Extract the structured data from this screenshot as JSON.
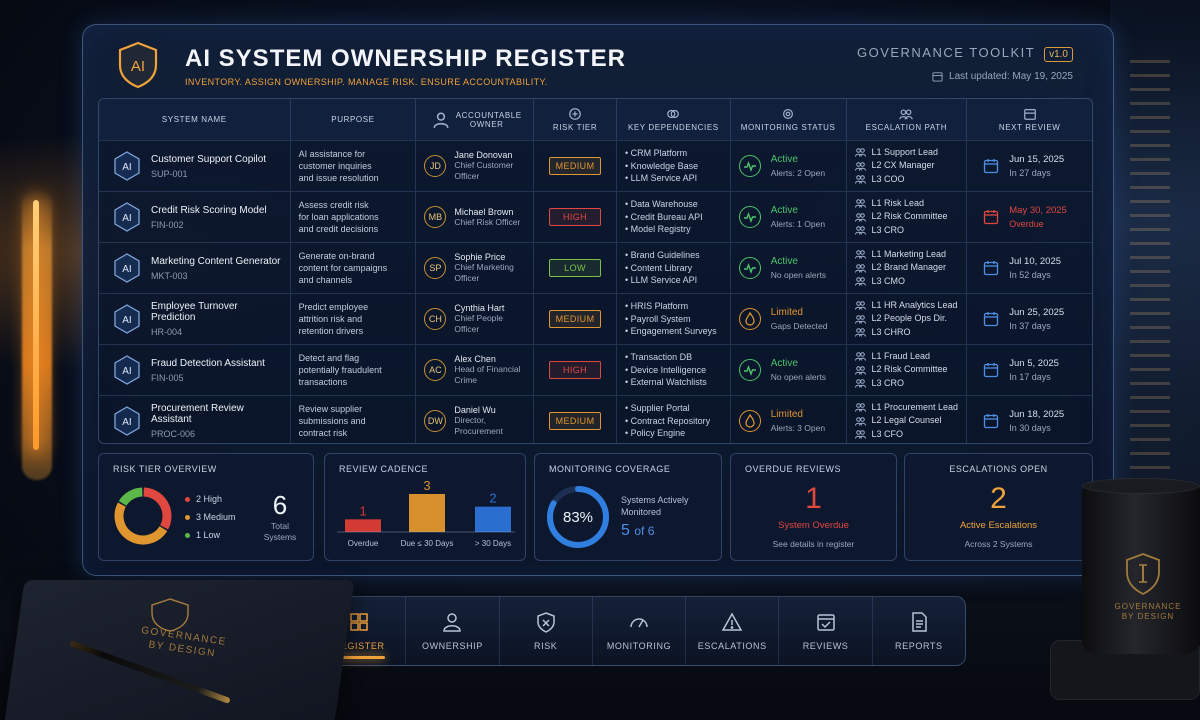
{
  "header": {
    "title": "AI SYSTEM OWNERSHIP REGISTER",
    "subtitle": "INVENTORY. ASSIGN OWNERSHIP. MANAGE RISK. ENSURE ACCOUNTABILITY.",
    "logo_text": "AI",
    "toolkit": "GOVERNANCE TOOLKIT",
    "version": "v1.0",
    "last_updated": "Last updated: May 19, 2025"
  },
  "table": {
    "columns": {
      "system": "SYSTEM NAME",
      "purpose": "PURPOSE",
      "owner": "ACCOUNTABLE OWNER",
      "risk": "RISK TIER",
      "deps": "KEY DEPENDENCIES",
      "monitoring": "MONITORING STATUS",
      "escalation": "ESCALATION PATH",
      "review": "NEXT REVIEW"
    },
    "rows": [
      {
        "icon": "AI",
        "name": "Customer Support Copilot",
        "id": "SUP-001",
        "purpose": [
          "AI assistance for",
          "customer inquiries",
          "and issue resolution"
        ],
        "initials": "JD",
        "owner": "Jane Donovan",
        "owner_title": [
          "Chief Customer",
          "Officer"
        ],
        "risk": "MEDIUM",
        "risk_color": "#e0962f",
        "deps": [
          "• CRM Platform",
          "• Knowledge Base",
          "• LLM Service API"
        ],
        "mon_status": "Active",
        "mon_sub": "Alerts: 2 Open",
        "mon_color": "#4cc46a",
        "mon_icon": "pulse",
        "escalation": [
          "L1 Support Lead",
          "L2 CX Manager",
          "L3 COO"
        ],
        "review_date": "Jun 15, 2025",
        "review_rel": "In 27 days",
        "review_color": "#d6dfec"
      },
      {
        "icon": "AI",
        "name": "Credit Risk Scoring Model",
        "id": "FIN-002",
        "purpose": [
          "Assess credit risk",
          "for loan applications",
          "and credit decisions"
        ],
        "initials": "MB",
        "owner": "Michael Brown",
        "owner_title": [
          "Chief Risk Officer"
        ],
        "risk": "HIGH",
        "risk_color": "#e0473f",
        "deps": [
          "• Data Warehouse",
          "• Credit Bureau API",
          "• Model Registry"
        ],
        "mon_status": "Active",
        "mon_sub": "Alerts: 1 Open",
        "mon_color": "#4cc46a",
        "mon_icon": "pulse",
        "escalation": [
          "L1 Risk Lead",
          "L2 Risk Committee",
          "L3 CRO"
        ],
        "review_date": "May 30, 2025",
        "review_rel": "Overdue",
        "review_color": "#e0473f"
      },
      {
        "icon": "AI",
        "name": "Marketing Content Generator",
        "id": "MKT-003",
        "purpose": [
          "Generate on-brand",
          "content for campaigns",
          "and channels"
        ],
        "initials": "SP",
        "owner": "Sophie Price",
        "owner_title": [
          "Chief Marketing",
          "Officer"
        ],
        "risk": "LOW",
        "risk_color": "#7cc04a",
        "deps": [
          "• Brand Guidelines",
          "• Content Library",
          "• LLM Service API"
        ],
        "mon_status": "Active",
        "mon_sub": "No open alerts",
        "mon_color": "#4cc46a",
        "mon_icon": "pulse",
        "escalation": [
          "L1 Marketing Lead",
          "L2 Brand Manager",
          "L3 CMO"
        ],
        "review_date": "Jul 10, 2025",
        "review_rel": "In 52 days",
        "review_color": "#d6dfec"
      },
      {
        "icon": "AI",
        "name": "Employee Turnover Prediction",
        "id": "HR-004",
        "purpose": [
          "Predict employee",
          "attrition risk and",
          "retention drivers"
        ],
        "initials": "CH",
        "owner": "Cynthia Hart",
        "owner_title": [
          "Chief People",
          "Officer"
        ],
        "risk": "MEDIUM",
        "risk_color": "#e0962f",
        "deps": [
          "• HRIS Platform",
          "• Payroll System",
          "• Engagement Surveys"
        ],
        "mon_status": "Limited",
        "mon_sub": "Gaps Detected",
        "mon_color": "#e0962f",
        "mon_icon": "flame",
        "escalation": [
          "L1 HR Analytics Lead",
          "L2 People Ops Dir.",
          "L3 CHRO"
        ],
        "review_date": "Jun 25, 2025",
        "review_rel": "In 37 days",
        "review_color": "#d6dfec"
      },
      {
        "icon": "AI",
        "name": "Fraud Detection Assistant",
        "id": "FIN-005",
        "purpose": [
          "Detect and flag",
          "potentially fraudulent",
          "transactions"
        ],
        "initials": "AC",
        "owner": "Alex Chen",
        "owner_title": [
          "Head of Financial",
          "Crime"
        ],
        "risk": "HIGH",
        "risk_color": "#e0473f",
        "deps": [
          "• Transaction DB",
          "• Device Intelligence",
          "• External Watchlists"
        ],
        "mon_status": "Active",
        "mon_sub": "No open alerts",
        "mon_color": "#4cc46a",
        "mon_icon": "pulse",
        "escalation": [
          "L1 Fraud Lead",
          "L2 Risk Committee",
          "L3 CRO"
        ],
        "review_date": "Jun 5, 2025",
        "review_rel": "In 17 days",
        "review_color": "#d6dfec"
      },
      {
        "icon": "AI",
        "name": "Procurement Review Assistant",
        "id": "PROC-006",
        "purpose": [
          "Review supplier",
          "submissions and",
          "contract risk"
        ],
        "initials": "DW",
        "owner": "Daniel Wu",
        "owner_title": [
          "Director,",
          "Procurement"
        ],
        "risk": "MEDIUM",
        "risk_color": "#e0962f",
        "deps": [
          "• Supplier Portal",
          "• Contract Repository",
          "• Policy Engine"
        ],
        "mon_status": "Limited",
        "mon_sub": "Alerts: 3 Open",
        "mon_color": "#e0962f",
        "mon_icon": "flame",
        "escalation": [
          "L1 Procurement Lead",
          "L2 Legal Counsel",
          "L3 CFO"
        ],
        "review_date": "Jun 18, 2025",
        "review_rel": "In 30 days",
        "review_color": "#d6dfec"
      }
    ]
  },
  "cards": {
    "risk_tier": {
      "title": "RISK TIER OVERVIEW",
      "items": [
        {
          "label": "2 High",
          "count": 2,
          "color": "#e0473f"
        },
        {
          "label": "3 Medium",
          "count": 3,
          "color": "#e0962f"
        },
        {
          "label": "1 Low",
          "count": 1,
          "color": "#5db84a"
        }
      ],
      "total": "6",
      "total_label": "Total",
      "total_label2": "Systems"
    },
    "review_cadence": {
      "title": "REVIEW CADENCE",
      "chart_data": {
        "type": "bar",
        "categories": [
          "Overdue",
          "Due ≤ 30 Days",
          "> 30 Days"
        ],
        "values": [
          1,
          3,
          2
        ],
        "colors": [
          "#d23a33",
          "#d8902c",
          "#2a6fd0"
        ]
      }
    },
    "monitoring": {
      "title": "MONITORING COVERAGE",
      "percent": "83%",
      "fraction": 0.83,
      "label1": "Systems Actively",
      "label2": "Monitored",
      "count_main": "5",
      "count_rest": "of 6"
    },
    "overdue": {
      "title": "OVERDUE REVIEWS",
      "value": "1",
      "label": "System Overdue",
      "sub": "See details in register"
    },
    "escalations": {
      "title": "ESCALATIONS OPEN",
      "value": "2",
      "label": "Active Escalations",
      "sub": "Across 2 Systems"
    }
  },
  "nav": {
    "items": [
      {
        "label": "REGISTER",
        "icon": "grid-icon",
        "active": true
      },
      {
        "label": "OWNERSHIP",
        "icon": "user-icon",
        "active": false
      },
      {
        "label": "RISK",
        "icon": "shield-icon",
        "active": false
      },
      {
        "label": "MONITORING",
        "icon": "gauge-icon",
        "active": false
      },
      {
        "label": "ESCALATIONS",
        "icon": "warning-icon",
        "active": false
      },
      {
        "label": "REVIEWS",
        "icon": "calendar-check-icon",
        "active": false
      },
      {
        "label": "REPORTS",
        "icon": "document-icon",
        "active": false
      }
    ]
  },
  "props": {
    "notebook_text": [
      "GOVERNANCE",
      "BY DESIGN"
    ],
    "mug_text": [
      "GOVERNANCE",
      "BY DESIGN"
    ]
  }
}
